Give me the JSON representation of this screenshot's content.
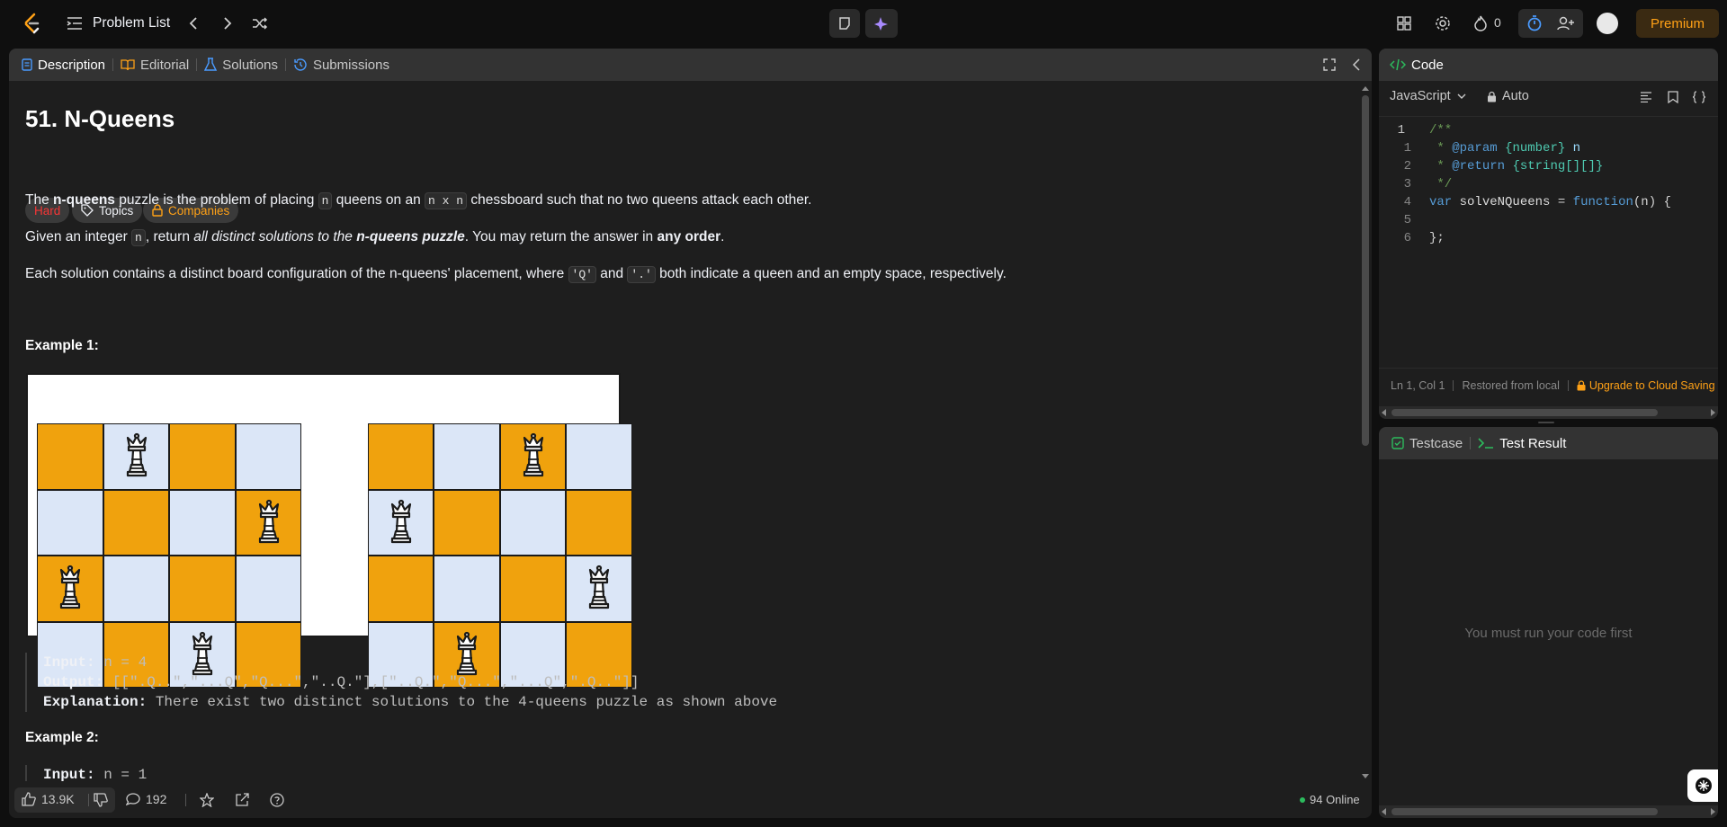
{
  "topbar": {
    "problem_list": "Problem List",
    "streak_count": "0",
    "premium": "Premium"
  },
  "left_tabs": [
    {
      "label": "Description"
    },
    {
      "label": "Editorial"
    },
    {
      "label": "Solutions"
    },
    {
      "label": "Submissions"
    }
  ],
  "problem": {
    "title": "51. N-Queens",
    "difficulty": "Hard",
    "topics": "Topics",
    "companies": "Companies",
    "p1": {
      "a": "The ",
      "b": "n-queens",
      "c": " puzzle is the problem of placing ",
      "code1": "n",
      "d": " queens on an ",
      "code2": "n x n",
      "e": " chessboard such that no two queens attack each other."
    },
    "p2": {
      "a": "Given an integer ",
      "code1": "n",
      "b": ", return ",
      "c": "all distinct solutions to the ",
      "d": "n-queens puzzle",
      "e": ". You may return the answer in ",
      "f": "any order",
      "g": "."
    },
    "p3": {
      "a": "Each solution contains a distinct board configuration of the n-queens' placement, where ",
      "code1": "'Q'",
      "b": " and ",
      "code2": "'.'",
      "c": " both indicate a queen and an empty space, respectively."
    },
    "example1_title": "Example 1:",
    "example1": {
      "input_label": "Input:",
      "input": " n = 4",
      "output_label": "Output:",
      "output": " [[\".Q..\",\"...Q\",\"Q...\",\"..Q.\"],[\"..Q.\",\"Q...\",\"...Q\",\".Q..\"]]",
      "explanation_label": "Explanation:",
      "explanation": " There exist two distinct solutions to the 4-queens puzzle as shown above"
    },
    "example2_title": "Example 2:",
    "example2": {
      "input_label": "Input:",
      "input": " n = 1"
    }
  },
  "footer": {
    "likes": "13.9K",
    "comments": "192",
    "online": "94 Online"
  },
  "code_panel": {
    "title": "Code",
    "language": "JavaScript",
    "auto": "Auto",
    "line_numbers": [
      "1",
      "1",
      "2",
      "3",
      "4",
      "5",
      "6"
    ],
    "lines": [
      "/**",
      " * @param {number} n",
      " * @return {string[][]}",
      " */",
      "var solveNQueens = function(n) {",
      "",
      "};"
    ],
    "status": {
      "position": "Ln 1, Col 1",
      "restored": "Restored from local",
      "upgrade": "Upgrade to Cloud Saving"
    }
  },
  "test_panel": {
    "testcase": "Testcase",
    "test_result": "Test Result",
    "empty_message": "You must run your code first"
  },
  "colors": {
    "accent_orange": "#ffa116",
    "hard_red": "#f63636",
    "board_orange": "#f0a20d",
    "board_blue": "#dbe6f7",
    "online_green": "#2cbb5d"
  }
}
